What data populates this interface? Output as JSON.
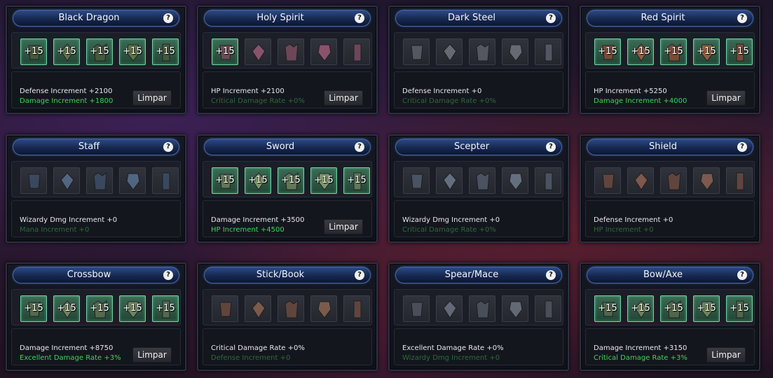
{
  "colors": {
    "active_slot": "#3b6a55",
    "stat_on": "#3fd35a",
    "stat_off": "#2c6a3b",
    "title_bar": "#1d3468"
  },
  "help_icon": "?",
  "clear_label": "Limpar",
  "cards": [
    {
      "title": "Black Dragon",
      "levels": [
        "+15",
        "+15",
        "+15",
        "+15",
        "+15"
      ],
      "stat1": "Defense Increment +2100",
      "stat2": "Damage Increment +1800",
      "stat2_on": true,
      "has_button": true
    },
    {
      "title": "Holy Spirit",
      "levels": [
        "+15",
        "",
        "",
        "",
        ""
      ],
      "stat1": "HP Increment +2100",
      "stat2": "Critical Damage Rate +0%",
      "stat2_on": false,
      "has_button": true
    },
    {
      "title": "Dark Steel",
      "levels": [
        "",
        "",
        "",
        "",
        ""
      ],
      "stat1": "Defense Increment +0",
      "stat2": "Critical Damage Rate +0%",
      "stat2_on": false,
      "has_button": false
    },
    {
      "title": "Red Spirit",
      "levels": [
        "+15",
        "+15",
        "+15",
        "+15",
        "+15"
      ],
      "stat1": "HP Increment +5250",
      "stat2": "Damage Increment +4000",
      "stat2_on": true,
      "has_button": true
    },
    {
      "title": "Staff",
      "levels": [
        "",
        "",
        "",
        "",
        ""
      ],
      "stat1": "Wizardy Dmg Increment +0",
      "stat2": "Mana Increment +0",
      "stat2_on": false,
      "has_button": false
    },
    {
      "title": "Sword",
      "levels": [
        "+15",
        "+15",
        "+15",
        "+15",
        "+15"
      ],
      "stat1": "Damage Increment +3500",
      "stat2": "HP Increment +4500",
      "stat2_on": true,
      "has_button": true
    },
    {
      "title": "Scepter",
      "levels": [
        "",
        "",
        "",
        "",
        ""
      ],
      "stat1": "Wizardy Dmg Increment +0",
      "stat2": "Critical Damage Rate +0%",
      "stat2_on": false,
      "has_button": false
    },
    {
      "title": "Shield",
      "levels": [
        "",
        "",
        "",
        "",
        ""
      ],
      "stat1": "Defense Increment +0",
      "stat2": "HP Increment +0",
      "stat2_on": false,
      "has_button": false
    },
    {
      "title": "Crossbow",
      "levels": [
        "+15",
        "+15",
        "+15",
        "+15",
        "+15"
      ],
      "stat1": "Damage Increment +8750",
      "stat2": "Excellent Damage Rate +3%",
      "stat2_on": true,
      "has_button": true
    },
    {
      "title": "Stick/Book",
      "levels": [
        "",
        "",
        "",
        "",
        ""
      ],
      "stat1": "Critical Damage Rate +0%",
      "stat2": "Defense Increment +0",
      "stat2_on": false,
      "has_button": false
    },
    {
      "title": "Spear/Mace",
      "levels": [
        "",
        "",
        "",
        "",
        ""
      ],
      "stat1": "Excellent Damage Rate +0%",
      "stat2": "Wizardy Dmg Increment +0",
      "stat2_on": false,
      "has_button": false
    },
    {
      "title": "Bow/Axe",
      "levels": [
        "+15",
        "+15",
        "+15",
        "+15",
        "+15"
      ],
      "stat1": "Damage Increment +3150",
      "stat2": "Critical Damage Rate +3%",
      "stat2_on": true,
      "has_button": true
    }
  ]
}
